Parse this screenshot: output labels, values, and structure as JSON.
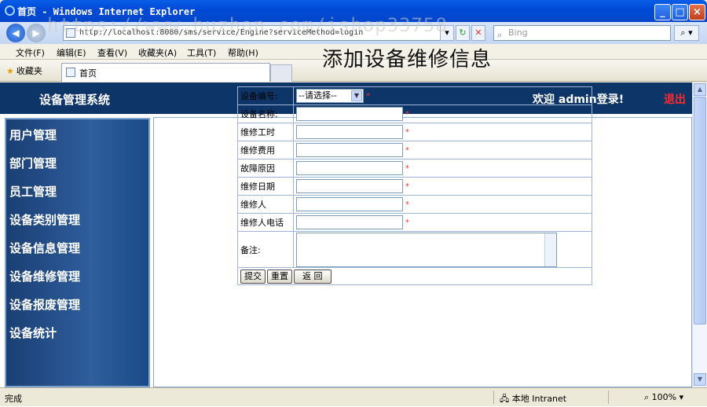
{
  "window": {
    "title": "首页 - Windows Internet Explorer",
    "minimize": "_",
    "maximize": "□",
    "close": "×"
  },
  "addressbar": {
    "url": "http://localhost:8080/sms/service/Engine?serviceMethod=login",
    "search_placeholder": "Bing"
  },
  "menu": [
    "文件(F)",
    "编辑(E)",
    "查看(V)",
    "收藏夹(A)",
    "工具(T)",
    "帮助(H)"
  ],
  "favbar": {
    "favorites_label": "收藏夹",
    "tab_label": "首页"
  },
  "header": {
    "system_name": "设备管理系统",
    "welcome": "欢迎 admin登录!",
    "logout": "退出"
  },
  "sidebar": {
    "items": [
      "用户管理",
      "部门管理",
      "员工管理",
      "设备类别管理",
      "设备信息管理",
      "设备维修管理",
      "设备报废管理",
      "设备统计"
    ]
  },
  "form": {
    "title": "添加设备维修信息",
    "select_placeholder": "--请选择--",
    "required_mark": "*",
    "fields": [
      {
        "label": "设备编号:"
      },
      {
        "label": "设备名称:"
      },
      {
        "label": "维修工时"
      },
      {
        "label": "维修费用"
      },
      {
        "label": "故障原因"
      },
      {
        "label": "维修日期"
      },
      {
        "label": "维修人"
      },
      {
        "label": "维修人电话"
      }
    ],
    "remark_label": "备注:",
    "buttons": {
      "submit": "提交",
      "reset": "重置",
      "back": "返 回"
    }
  },
  "statusbar": {
    "status": "完成",
    "zone": "本地 Intranet",
    "zoom": "100%"
  },
  "watermark": "https://www.huzhan.com/ishop33758"
}
